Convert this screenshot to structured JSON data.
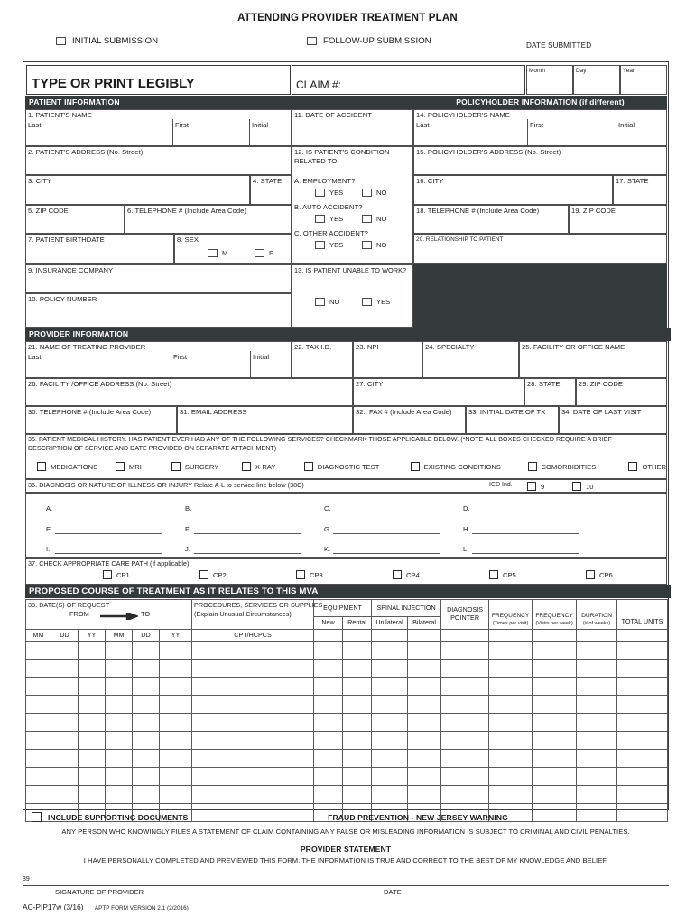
{
  "document": {
    "title": "ATTENDING PROVIDER TREATMENT PLAN",
    "initial_submission": "INITIAL SUBMISSION",
    "followup_submission": "FOLLOW-UP SUBMISSION",
    "date_submitted": "DATE SUBMITTED",
    "date_month": "Month",
    "date_day": "Day",
    "date_year": "Year",
    "type_or_print": "TYPE OR PRINT LEGIBLY",
    "claim": "CLAIM #:"
  },
  "colors": {
    "band": "#333a39",
    "border": "#4e4e4e",
    "frame": "#3b3b3b",
    "paper": "#ffffff"
  },
  "patient": {
    "band": "PATIENT INFORMATION",
    "f1": "1. PATIENT'S NAME",
    "last": "Last",
    "first": "First",
    "initial": "Initial",
    "f2": "2. PATIENT'S ADDRESS (No. Street)",
    "f3": "3. CITY",
    "f4": "4. STATE",
    "f5": "5. ZIP CODE",
    "f6": "6. TELEPHONE # (Include Area Code)",
    "f7": "7. PATIENT BIRTHDATE",
    "f8": "8. SEX",
    "sex_m": "M",
    "sex_f": "F",
    "f9": "9. INSURANCE COMPANY",
    "f10": "10. POLICY NUMBER"
  },
  "accident": {
    "f11": "11. DATE OF ACCIDENT",
    "f12_l1": "12. IS PATIENT'S CONDITION",
    "f12_l2": "RELATED TO:",
    "a": "A. EMPLOYMENT?",
    "b": "B. AUTO ACCIDENT?",
    "c": "C. OTHER ACCIDENT?",
    "yes": "YES",
    "no": "NO",
    "f13": "13. IS PATIENT UNABLE TO WORK?"
  },
  "policyholder": {
    "band": "POLICYHOLDER INFORMATION (if different)",
    "f14": "14. POLICYHOLDER'S NAME",
    "last": "Last",
    "first": "First",
    "initial": "Initial",
    "f15": "15. POLICYHOLDER'S ADDRESS (No. Street)",
    "f16": "16. CITY",
    "f17": "17. STATE",
    "f18": "18. TELEPHONE # (Include Area Code)",
    "f19": "19. ZIP CODE",
    "f20": "20. RELATIONSHIP TO PATIENT"
  },
  "provider": {
    "band": "PROVIDER INFORMATION",
    "f21": "21. NAME OF TREATING PROVIDER",
    "last": "Last",
    "first": "First",
    "initial": "Initial",
    "f22": "22. TAX I.D.",
    "f23": "23. NPI",
    "f24": "24. SPECIALTY",
    "f25": "25. FACILITY OR OFFICE NAME",
    "f26": "26. FACILITY /OFFICE ADDRESS (No. Street)",
    "f27": "27. CITY",
    "f28": "28. STATE",
    "f29": "29. ZIP CODE",
    "f30": "30. TELEPHONE # (Include Area Code)",
    "f31": "31. EMAIL ADDRESS",
    "f32": "32.. FAX # (Include Area Code)",
    "f33": "33. INITIAL DATE OF TX",
    "f34": "34. DATE OF LAST VISIT"
  },
  "history": {
    "f35_l1": "35. PATIENT MEDICAL HISTORY. HAS PATIENT EVER HAD ANY OF THE FOLLOWING SERVICES?   CHECKMARK THOSE APPLICABLE BELOW.  (*NOTE-ALL BOXES CHECKED REQUIRE A BRIEF",
    "f35_l2": "DESCRIPTION OF SERVICE AND DATE PROVIDED ON SEPARATE ATTACHMENT)",
    "options": [
      "MEDICATIONS",
      "MRI",
      "SURGERY",
      "X-RAY",
      "DIAGNOSTIC TEST",
      "EXISTING CONDITIONS",
      "COMORBIDITIES",
      "OTHER"
    ]
  },
  "diagnosis": {
    "f36": "36. DIAGNOSIS OR NATURE OF ILLNESS OR INJURY Relate A-L to service line below (38C)",
    "icd_label": "ICD Ind.",
    "icd9": "9",
    "icd10": "10",
    "letters": [
      "A.",
      "B.",
      "C.",
      "D.",
      "E.",
      "F.",
      "G.",
      "H.",
      "I.",
      "J.",
      "K.",
      "L."
    ]
  },
  "carepath": {
    "f37": "37. CHECK APPROPRIATE CARE PATH (if applicable)",
    "options": [
      "CP1",
      "CP2",
      "CP3",
      "CP4",
      "CP5",
      "CP6"
    ]
  },
  "treatment": {
    "band": "PROPOSED COURSE OF TREATMENT AS IT RELATES TO THIS MVA",
    "f38": "38. DATE(S) OF REQUEST",
    "from": "FROM",
    "to": "TO",
    "mm": "MM",
    "dd": "DD",
    "yy": "YY",
    "procedures_l1": "PROCEDURES, SERVICES OR SUPPLIES",
    "procedures_l2": "(Explain Unusual Circumstances)",
    "cpt": "CPT/HCPCS",
    "equipment": "EQUIPMENT",
    "equip_new": "New",
    "equip_rental": "Rental",
    "spinal": "SPINAL INJECTION",
    "spinal_uni": "Unilateral",
    "spinal_bi": "Bilateral",
    "dx_pointer_l1": "DIAGNOSIS",
    "dx_pointer_l2": "POINTER",
    "freq1": "FREQUENCY",
    "freq1_sub": "(Times per visit)",
    "freq2": "FREQUENCY",
    "freq2_sub": "(Visits per week)",
    "duration": "DURATION",
    "duration_sub": "(# of weeks)",
    "total_units": "TOTAL UNITS",
    "row_count": 10
  },
  "footer": {
    "include_docs": "INCLUDE SUPPORTING DOCUMENTS",
    "fraud_title": "FRAUD PREVENTION - NEW JERSEY WARNING",
    "fraud_text": "ANY PERSON WHO KNOWINGLY FILES A STATEMENT OF CLAIM CONTAINING ANY FALSE OR MISLEADING INFORMATION IS SUBJECT TO CRIMINAL AND CIVIL PENALTIES.",
    "stmt_title": "PROVIDER STATEMENT",
    "stmt_text": "I HAVE PERSONALLY COMPLETED AND PREVIEWED THIS FORM.  THE INFORMATION IS TRUE AND CORRECT TO THE BEST OF MY KNOWLEDGE AND BELIEF.",
    "sig_number": "39",
    "sig_provider": "SIGNATURE OF PROVIDER",
    "sig_date": "DATE",
    "form_id": "AC-PIP17w (3/16)",
    "form_version": "APTP FORM VERSION 2.1 (2/2016)"
  }
}
